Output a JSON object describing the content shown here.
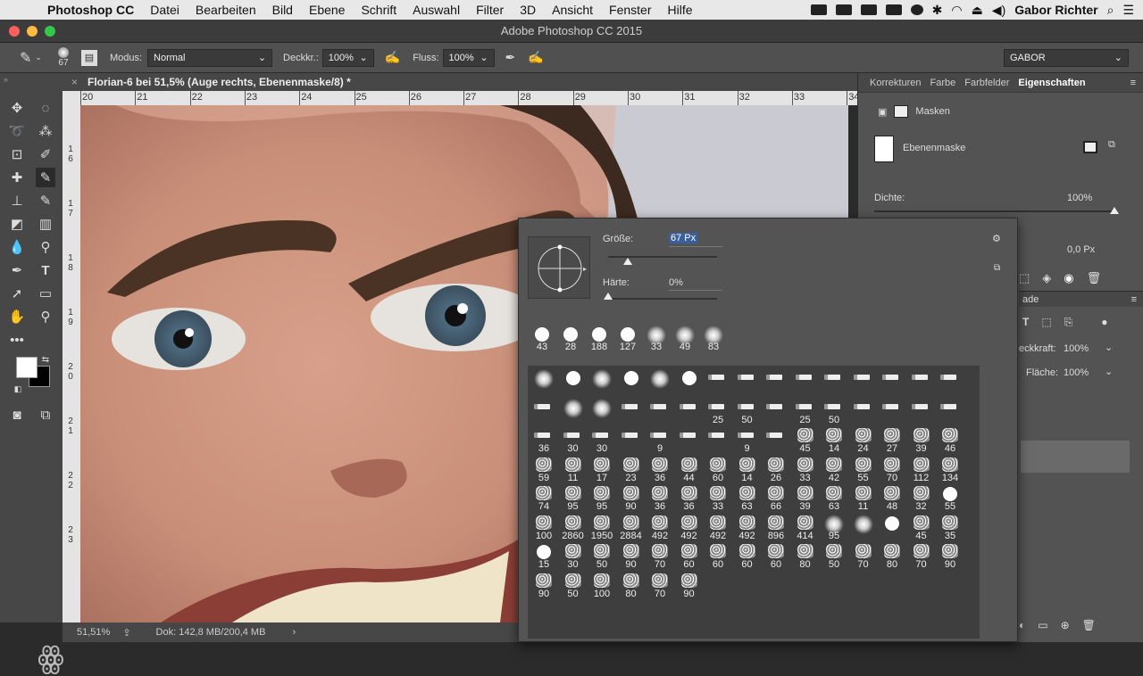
{
  "menubar": {
    "app": "Photoshop CC",
    "items": [
      "Datei",
      "Bearbeiten",
      "Bild",
      "Ebene",
      "Schrift",
      "Auswahl",
      "Filter",
      "3D",
      "Ansicht",
      "Fenster",
      "Hilfe"
    ],
    "user": "Gabor Richter"
  },
  "window": {
    "title": "Adobe Photoshop CC 2015"
  },
  "options": {
    "brush_size": "67",
    "mode_label": "Modus:",
    "mode_value": "Normal",
    "opacity_label": "Deckkr.:",
    "opacity_value": "100%",
    "flow_label": "Fluss:",
    "flow_value": "100%",
    "workspace": "GABOR"
  },
  "document": {
    "tab_title": "Florian-6 bei 51,5% (Auge rechts, Ebenenmaske/8) *",
    "zoom": "51,51%",
    "doc_info": "Dok: 142,8 MB/200,4 MB",
    "ruler_ticks": [
      "20",
      "21",
      "22",
      "23",
      "24",
      "25",
      "26",
      "27",
      "28",
      "29",
      "30",
      "31",
      "32",
      "33",
      "34"
    ],
    "vruler_labels": [
      "1 6",
      "1 7",
      "1 8",
      "1 9",
      "2 0",
      "2 1",
      "2 2",
      "2 3"
    ]
  },
  "panels": {
    "tabs": [
      "Korrekturen",
      "Farbe",
      "Farbfelder",
      "Eigenschaften"
    ],
    "masks_label": "Masken",
    "layer_mask_label": "Ebenenmaske",
    "density_label": "Dichte:",
    "density_value": "100%",
    "feather_value": "0,0 Px",
    "layers_label": "ade",
    "opacity_label": "eckkraft:",
    "opacity_value": "100%",
    "fill_label": "Fläche:",
    "fill_value": "100%"
  },
  "brush_picker": {
    "size_label": "Größe:",
    "size_value": "67 Px",
    "size_fraction": 0.18,
    "hardness_label": "Härte:",
    "hardness_value": "0%",
    "hardness_fraction": 0.0,
    "preset_rows": [
      [
        {
          "n": "43",
          "k": "h"
        },
        {
          "n": "28",
          "k": "h"
        },
        {
          "n": "188",
          "k": "h"
        },
        {
          "n": "127",
          "k": "h"
        },
        {
          "n": "33",
          "k": "s"
        },
        {
          "n": "49",
          "k": "s"
        },
        {
          "n": "83",
          "k": "s"
        }
      ],
      [
        {
          "n": "",
          "k": "s"
        },
        {
          "n": "",
          "k": "h"
        },
        {
          "n": "",
          "k": "s"
        },
        {
          "n": "",
          "k": "h"
        },
        {
          "n": "",
          "k": "s"
        },
        {
          "n": "",
          "k": "h"
        },
        {
          "n": "",
          "k": "d"
        },
        {
          "n": "",
          "k": "d"
        },
        {
          "n": "",
          "k": "d"
        },
        {
          "n": "",
          "k": "d"
        },
        {
          "n": "",
          "k": "d"
        },
        {
          "n": "",
          "k": "d"
        },
        {
          "n": "",
          "k": "d"
        },
        {
          "n": "",
          "k": "d"
        },
        {
          "n": "",
          "k": "d"
        }
      ],
      [
        {
          "n": "",
          "k": "d"
        },
        {
          "n": "",
          "k": "s"
        },
        {
          "n": "",
          "k": "s"
        },
        {
          "n": "",
          "k": "d"
        },
        {
          "n": "",
          "k": "d"
        },
        {
          "n": "",
          "k": "d"
        },
        {
          "n": "25",
          "k": "d"
        },
        {
          "n": "50",
          "k": "d"
        },
        {
          "n": "",
          "k": "d"
        },
        {
          "n": "25",
          "k": "d"
        },
        {
          "n": "50",
          "k": "d"
        },
        {
          "n": "",
          "k": "d"
        },
        {
          "n": "",
          "k": "d"
        },
        {
          "n": "",
          "k": "d"
        },
        {
          "n": "",
          "k": "d"
        }
      ],
      [
        {
          "n": "36",
          "k": "d"
        },
        {
          "n": "30",
          "k": "d"
        },
        {
          "n": "30",
          "k": "d"
        },
        {
          "n": "",
          "k": "d"
        },
        {
          "n": "9",
          "k": "d"
        },
        {
          "n": "",
          "k": "d"
        },
        {
          "n": "",
          "k": "d"
        },
        {
          "n": "9",
          "k": "d"
        },
        {
          "n": "",
          "k": "d"
        },
        {
          "n": "45",
          "k": "t"
        },
        {
          "n": "14",
          "k": "t"
        },
        {
          "n": "24",
          "k": "t"
        },
        {
          "n": "27",
          "k": "t"
        },
        {
          "n": "39",
          "k": "t"
        },
        {
          "n": "46",
          "k": "t"
        }
      ],
      [
        {
          "n": "59",
          "k": "t"
        },
        {
          "n": "11",
          "k": "t"
        },
        {
          "n": "17",
          "k": "t"
        },
        {
          "n": "23",
          "k": "t"
        },
        {
          "n": "36",
          "k": "t"
        },
        {
          "n": "44",
          "k": "t"
        },
        {
          "n": "60",
          "k": "t"
        },
        {
          "n": "14",
          "k": "t"
        },
        {
          "n": "26",
          "k": "t"
        },
        {
          "n": "33",
          "k": "t"
        },
        {
          "n": "42",
          "k": "t"
        },
        {
          "n": "55",
          "k": "t"
        },
        {
          "n": "70",
          "k": "t"
        },
        {
          "n": "112",
          "k": "t"
        },
        {
          "n": "134",
          "k": "t"
        }
      ],
      [
        {
          "n": "74",
          "k": "t"
        },
        {
          "n": "95",
          "k": "t"
        },
        {
          "n": "95",
          "k": "t"
        },
        {
          "n": "90",
          "k": "t"
        },
        {
          "n": "36",
          "k": "t"
        },
        {
          "n": "36",
          "k": "t"
        },
        {
          "n": "33",
          "k": "t"
        },
        {
          "n": "63",
          "k": "t"
        },
        {
          "n": "66",
          "k": "t"
        },
        {
          "n": "39",
          "k": "t"
        },
        {
          "n": "63",
          "k": "t"
        },
        {
          "n": "11",
          "k": "t"
        },
        {
          "n": "48",
          "k": "t"
        },
        {
          "n": "32",
          "k": "t"
        },
        {
          "n": "55",
          "k": "h"
        }
      ],
      [
        {
          "n": "100",
          "k": "t"
        },
        {
          "n": "2860",
          "k": "t"
        },
        {
          "n": "1950",
          "k": "t"
        },
        {
          "n": "2884",
          "k": "t"
        },
        {
          "n": "492",
          "k": "t"
        },
        {
          "n": "492",
          "k": "t"
        },
        {
          "n": "492",
          "k": "t"
        },
        {
          "n": "492",
          "k": "t"
        },
        {
          "n": "896",
          "k": "t"
        },
        {
          "n": "414",
          "k": "t"
        },
        {
          "n": "95",
          "k": "s"
        },
        {
          "n": "",
          "k": "s"
        },
        {
          "n": "",
          "k": "h"
        },
        {
          "n": "45",
          "k": "t"
        },
        {
          "n": "35",
          "k": "t"
        }
      ],
      [
        {
          "n": "15",
          "k": "h"
        },
        {
          "n": "30",
          "k": "t"
        },
        {
          "n": "50",
          "k": "t"
        },
        {
          "n": "90",
          "k": "t"
        },
        {
          "n": "70",
          "k": "t"
        },
        {
          "n": "60",
          "k": "t"
        },
        {
          "n": "60",
          "k": "t"
        },
        {
          "n": "60",
          "k": "t"
        },
        {
          "n": "60",
          "k": "t"
        },
        {
          "n": "80",
          "k": "t"
        },
        {
          "n": "50",
          "k": "t"
        },
        {
          "n": "70",
          "k": "t"
        },
        {
          "n": "80",
          "k": "t"
        },
        {
          "n": "70",
          "k": "t"
        },
        {
          "n": "90",
          "k": "t"
        }
      ],
      [
        {
          "n": "90",
          "k": "t"
        },
        {
          "n": "50",
          "k": "t"
        },
        {
          "n": "100",
          "k": "t"
        },
        {
          "n": "80",
          "k": "t"
        },
        {
          "n": "70",
          "k": "t"
        },
        {
          "n": "90",
          "k": "t"
        }
      ]
    ]
  },
  "colors": {
    "accent_selection": "#3a5f9e",
    "panel_bg": "#535353"
  }
}
